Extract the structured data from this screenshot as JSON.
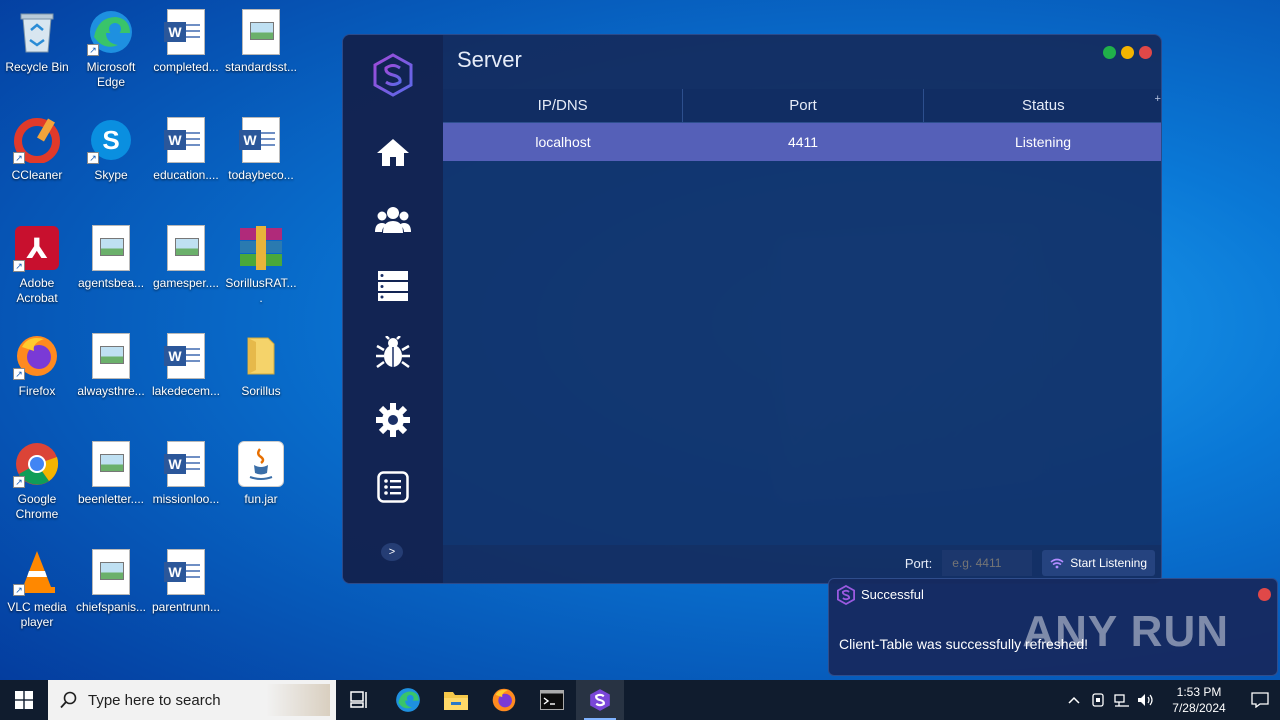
{
  "desktop": {
    "icons": [
      {
        "label": "Recycle Bin",
        "icon": "recycle-bin-icon"
      },
      {
        "label": "Microsoft Edge",
        "icon": "edge-icon"
      },
      {
        "label": "completed...",
        "icon": "word-doc-icon"
      },
      {
        "label": "standardsst...",
        "icon": "image-doc-icon"
      },
      {
        "label": "CCleaner",
        "icon": "ccleaner-icon"
      },
      {
        "label": "Skype",
        "icon": "skype-icon"
      },
      {
        "label": "education....",
        "icon": "word-doc-icon"
      },
      {
        "label": "todaybeco...",
        "icon": "word-doc-icon"
      },
      {
        "label": "Adobe Acrobat",
        "icon": "acrobat-icon"
      },
      {
        "label": "agentsbea...",
        "icon": "image-doc-icon"
      },
      {
        "label": "gamesper....",
        "icon": "image-doc-icon"
      },
      {
        "label": "SorillusRAT....",
        "icon": "winrar-icon"
      },
      {
        "label": "Firefox",
        "icon": "firefox-icon"
      },
      {
        "label": "alwaysthre...",
        "icon": "image-doc-icon"
      },
      {
        "label": "lakedecem...",
        "icon": "word-doc-icon"
      },
      {
        "label": "Sorillus",
        "icon": "folder-icon"
      },
      {
        "label": "Google Chrome",
        "icon": "chrome-icon"
      },
      {
        "label": "beenletter....",
        "icon": "image-doc-icon"
      },
      {
        "label": "missionloo...",
        "icon": "word-doc-icon"
      },
      {
        "label": "fun.jar",
        "icon": "java-icon"
      },
      {
        "label": "VLC media player",
        "icon": "vlc-icon"
      },
      {
        "label": "chiefspanis...",
        "icon": "image-doc-icon"
      },
      {
        "label": "parentrunn...",
        "icon": "word-doc-icon"
      }
    ]
  },
  "app": {
    "title": "Server",
    "sidebar": [
      "home-icon",
      "users-icon",
      "server-list-icon",
      "bug-icon",
      "settings-icon",
      "log-list-icon"
    ],
    "expand_label": ">",
    "table": {
      "columns": [
        "IP/DNS",
        "Port",
        "Status"
      ],
      "add_label": "+",
      "rows": [
        {
          "ip": "localhost",
          "port": "4411",
          "status": "Listening"
        }
      ]
    },
    "footer": {
      "port_label": "Port:",
      "port_placeholder": "e.g. 4411",
      "start_label": "Start Listening"
    },
    "colors": {
      "accent": "#5560b8",
      "close": "#e04848",
      "minimize": "#f4b400",
      "maximize": "#20b04a"
    }
  },
  "toast": {
    "title": "Successful",
    "message": "Client-Table was successfully refreshed!",
    "watermark": "ANY RUN"
  },
  "taskbar": {
    "search_placeholder": "Type here to search",
    "apps": [
      "task-view-icon",
      "edge-icon",
      "file-explorer-icon",
      "firefox-icon",
      "terminal-icon",
      "sorillus-icon"
    ],
    "time": "1:53 PM",
    "date": "7/28/2024"
  }
}
